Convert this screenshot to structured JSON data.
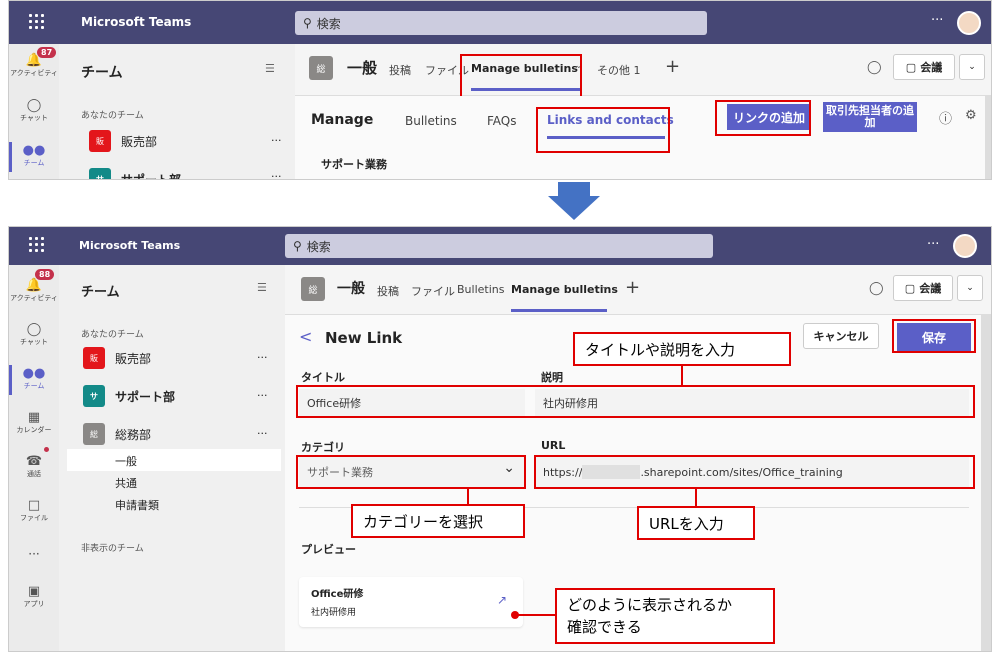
{
  "top_app": {
    "app_name": "Microsoft Teams",
    "search_placeholder": "検索",
    "more": "···",
    "rail": {
      "activity_badge": "87",
      "activity": "アクティビティ",
      "chat": "チャット",
      "teams": "チーム"
    },
    "panel_title": "チーム",
    "your_teams": "あなたのチーム",
    "teams": [
      {
        "avatar": "販",
        "name": "販売部",
        "color": "#e3161b"
      },
      {
        "avatar": "サ",
        "name": "サポート部",
        "color": "#138a88"
      }
    ],
    "team_more": "···",
    "channel_avatar": "総",
    "channel_name": "一般",
    "tabs": [
      "投稿",
      "ファイル",
      "Manage bulletins",
      "その他 1"
    ],
    "plus": "+",
    "meet": "会議",
    "manage_title": "Manage",
    "manage_tabs": [
      "Bulletins",
      "FAQs",
      "Links and contacts"
    ],
    "add_link": "リンクの追加",
    "add_contact": "取引先担当者の追加",
    "section": "サポート業務"
  },
  "bottom_app": {
    "app_name": "Microsoft Teams",
    "search_placeholder": "検索",
    "more": "···",
    "rail": [
      {
        "label": "アクティビティ",
        "icon": "bell-icon",
        "badge": "88"
      },
      {
        "label": "チャット",
        "icon": "chat-icon"
      },
      {
        "label": "チーム",
        "icon": "teams-icon"
      },
      {
        "label": "カレンダー",
        "icon": "calendar-icon"
      },
      {
        "label": "通話",
        "icon": "phone-icon"
      },
      {
        "label": "ファイル",
        "icon": "file-icon"
      },
      {
        "label": "···",
        "icon": "more-icon"
      },
      {
        "label": "アプリ",
        "icon": "apps-icon"
      }
    ],
    "panel_title": "チーム",
    "your_teams": "あなたのチーム",
    "teams": [
      {
        "avatar": "販",
        "name": "販売部",
        "color": "#e3161b"
      },
      {
        "avatar": "サ",
        "name": "サポート部",
        "color": "#138a88"
      },
      {
        "avatar": "総",
        "name": "総務部",
        "color": "#8a8886"
      }
    ],
    "team_more": "···",
    "channels": [
      "一般",
      "共通",
      "申請書類"
    ],
    "hidden_teams": "非表示のチーム",
    "channel_avatar": "総",
    "channel_name": "一般",
    "tabs": [
      "投稿",
      "ファイル",
      "Bulletins",
      "Manage bulletins"
    ],
    "plus": "+",
    "meet": "会議",
    "form": {
      "back": "<",
      "title": "New Link",
      "cancel": "キャンセル",
      "save": "保存",
      "title_label": "タイトル",
      "title_value": "Office研修",
      "desc_label": "説明",
      "desc_value": "社内研修用",
      "category_label": "カテゴリ",
      "category_value": "サポート業務",
      "url_label": "URL",
      "url_prefix": "https://",
      "url_suffix": ".sharepoint.com/sites/Office_training",
      "preview_label": "プレビュー",
      "preview_title": "Office研修",
      "preview_desc": "社内研修用"
    }
  },
  "callouts": {
    "title_desc": "タイトルや説明を入力",
    "category": "カテゴリーを選択",
    "url": "URLを入力",
    "preview_line1": "どのように表示されるか",
    "preview_line2": "確認できる"
  }
}
